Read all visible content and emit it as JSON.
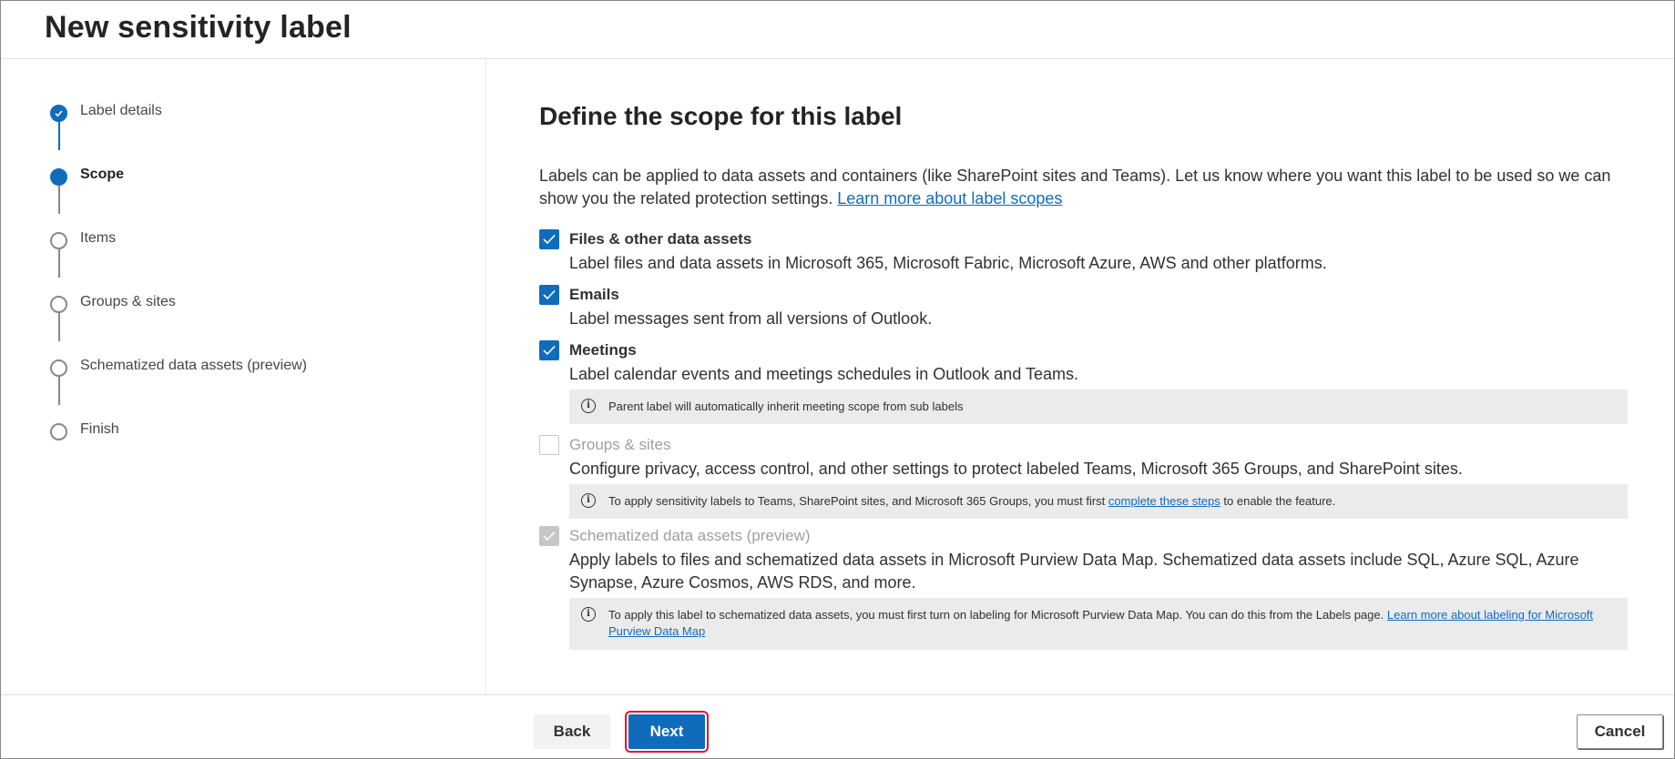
{
  "header": {
    "title": "New sensitivity label"
  },
  "steps": [
    {
      "label": "Label details",
      "state": "done"
    },
    {
      "label": "Scope",
      "state": "current"
    },
    {
      "label": "Items",
      "state": "pending"
    },
    {
      "label": "Groups & sites",
      "state": "pending"
    },
    {
      "label": "Schematized data assets (preview)",
      "state": "pending"
    },
    {
      "label": "Finish",
      "state": "pending"
    }
  ],
  "main": {
    "title": "Define the scope for this label",
    "intro": "Labels can be applied to data assets and containers (like SharePoint sites and Teams). Let us know where you want this label to be used so we can show you the related protection settings.",
    "intro_link": "Learn more about label scopes",
    "options": [
      {
        "title": "Files & other data assets",
        "description": "Label files and data assets in Microsoft 365, Microsoft Fabric, Microsoft Azure, AWS and other platforms.",
        "checked": true,
        "enabled": true
      },
      {
        "title": "Emails",
        "description": "Label messages sent from all versions of Outlook.",
        "checked": true,
        "enabled": true
      },
      {
        "title": "Meetings",
        "description": "Label calendar events and meetings schedules in Outlook and Teams.",
        "checked": true,
        "enabled": true,
        "info": "Parent label will automatically inherit meeting scope from sub labels"
      },
      {
        "title": "Groups & sites",
        "description": "Configure privacy, access control, and other settings to protect labeled Teams, Microsoft 365 Groups, and SharePoint sites.",
        "checked": false,
        "enabled": false,
        "info_before": "To apply sensitivity labels to Teams, SharePoint sites, and Microsoft 365 Groups, you must first",
        "info_link": "complete these steps",
        "info_after": "to enable the feature."
      },
      {
        "title": "Schematized data assets (preview)",
        "description": "Apply labels to files and schematized data assets in Microsoft Purview Data Map. Schematized data assets include SQL, Azure SQL, Azure Synapse, Azure Cosmos, AWS RDS, and more.",
        "checked": true,
        "enabled": false,
        "info_before": "To apply this label to schematized data assets, you must first turn on labeling for Microsoft Purview Data Map. You can do this from the Labels page.",
        "info_link": "Learn more about labeling for Microsoft Purview Data Map"
      }
    ]
  },
  "footer": {
    "back": "Back",
    "next": "Next",
    "cancel": "Cancel"
  },
  "colors": {
    "accent": "#0f6cbd",
    "highlight": "#e81123"
  },
  "icons": {
    "step_done": "check-icon",
    "info": "info-icon",
    "checkbox": "checkmark-icon"
  }
}
